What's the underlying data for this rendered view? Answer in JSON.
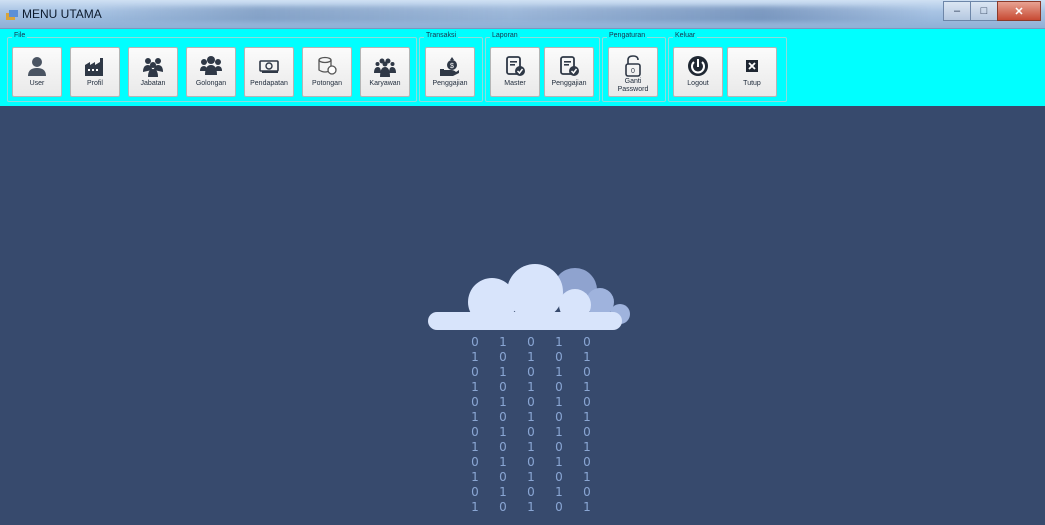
{
  "window": {
    "title": "MENU UTAMA",
    "controls": [
      "minimize",
      "maximize",
      "close"
    ]
  },
  "ribbon": {
    "groups": [
      {
        "title": "File",
        "buttons": [
          {
            "label": "User",
            "icon": "user-icon"
          },
          {
            "label": "Profil",
            "icon": "factory-icon"
          },
          {
            "label": "Jabatan",
            "icon": "team-icon"
          },
          {
            "label": "Golongan",
            "icon": "group-icon"
          },
          {
            "label": "Pendapatan",
            "icon": "money-icon"
          },
          {
            "label": "Potongan",
            "icon": "coins-icon"
          },
          {
            "label": "Karyawan",
            "icon": "employees-icon"
          }
        ]
      },
      {
        "title": "Transaksi",
        "buttons": [
          {
            "label": "Penggajian",
            "icon": "money-hand-icon"
          }
        ]
      },
      {
        "title": "Laporan",
        "buttons": [
          {
            "label": "Master",
            "icon": "report-check-icon"
          },
          {
            "label": "Penggajian",
            "icon": "report-check-icon"
          }
        ]
      },
      {
        "title": "Pengaturan",
        "buttons": [
          {
            "label": "Ganti Password",
            "icon": "lock-icon"
          }
        ]
      },
      {
        "title": "Keluar",
        "buttons": [
          {
            "label": "Logout",
            "icon": "power-icon"
          },
          {
            "label": "Tutup",
            "icon": "close-box-icon"
          }
        ]
      }
    ]
  },
  "background": {
    "color": "#374a6d",
    "rain_columns": [
      "0\n1\n0\n1\n0\n1\n0\n1\n0\n1\n0\n1",
      "1\n0\n1\n0\n1\n0\n1\n0\n1\n0\n1\n0",
      "0\n1\n0\n1\n0\n1\n0\n1\n0\n1\n0\n1",
      "1\n0\n1\n0\n1\n0\n1\n0\n1\n0\n1\n0",
      "0\n1\n0\n1\n0\n1\n0\n1\n0\n1\n0\n1"
    ]
  }
}
